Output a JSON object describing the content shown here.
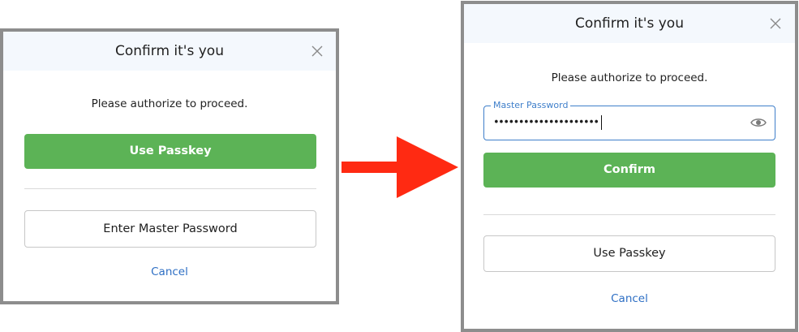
{
  "before": {
    "title": "Confirm it's you",
    "prompt": "Please authorize to proceed.",
    "primary_button": "Use Passkey",
    "secondary_button": "Enter Master Password",
    "cancel": "Cancel"
  },
  "after": {
    "title": "Confirm it's you",
    "prompt": "Please authorize to proceed.",
    "password_field": {
      "label": "Master Password",
      "masked_value": "•••••••••••••••••••••"
    },
    "primary_button": "Confirm",
    "secondary_button": "Use Passkey",
    "cancel": "Cancel"
  },
  "colors": {
    "accent_green": "#5cb356",
    "link_blue": "#2e6fc4",
    "arrow_red": "#ff2a12",
    "header_bg": "#f4f8fd"
  },
  "icons": {
    "close": "close-icon",
    "show_password": "eye-icon",
    "transition": "arrow-right-icon"
  }
}
